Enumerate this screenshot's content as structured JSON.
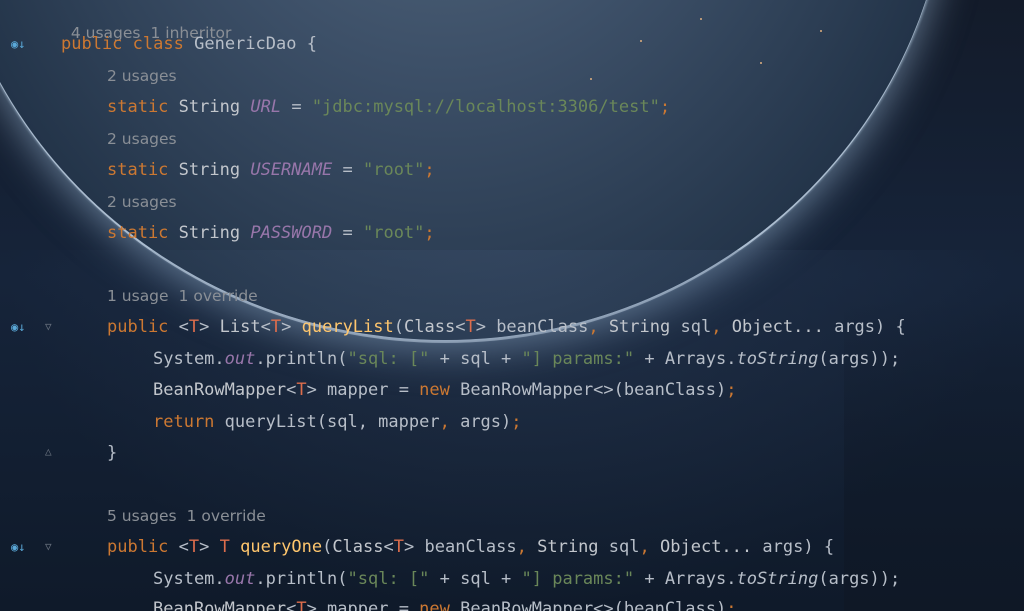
{
  "editor": {
    "hints": {
      "class": [
        "4 usages",
        "1 inheritor"
      ],
      "url": [
        "2 usages"
      ],
      "username": [
        "2 usages"
      ],
      "password": [
        "2 usages"
      ],
      "querylist": [
        "1 usage",
        "1 override"
      ],
      "queryone": [
        "5 usages",
        "1 override"
      ]
    },
    "code": {
      "class_kw1": "public",
      "class_kw2": "class",
      "class_name": "GenericDao",
      "brace_open": "{",
      "static_kw": "static",
      "string_type": "String",
      "url_field": "URL",
      "url_value": "\"jdbc:mysql://localhost:3306/test\"",
      "username_field": "USERNAME",
      "root_value": "\"root\"",
      "password_field": "PASSWORD",
      "equals": "=",
      "semicolon": ";",
      "public_kw": "public",
      "generic_t": "T",
      "list_type": "List",
      "querylist_name": "queryList",
      "class_type": "Class",
      "bean_class_param": "beanClass",
      "sql_param": "sql",
      "object_type": "Object...",
      "args_param": "args",
      "system": "System.",
      "out": "out",
      "println": ".println(",
      "sql_str": "\"sql: [\"",
      "plus_sql_plus": " + sql + ",
      "params_str": "\"] params:\"",
      "plus_arrays": " + Arrays.",
      "tostring": "toString",
      "args_close": "(args));",
      "bean_row_mapper": "BeanRowMapper",
      "mapper_assign": " mapper = ",
      "new_kw": "new",
      "bean_row_mapper_new": " BeanRowMapper<>(beanClass)",
      "return_kw": "return",
      "querylist_call": " queryList(sql, mapper",
      "args_end": " args)",
      "brace_close": "}",
      "queryone_name": "queryOne"
    }
  }
}
